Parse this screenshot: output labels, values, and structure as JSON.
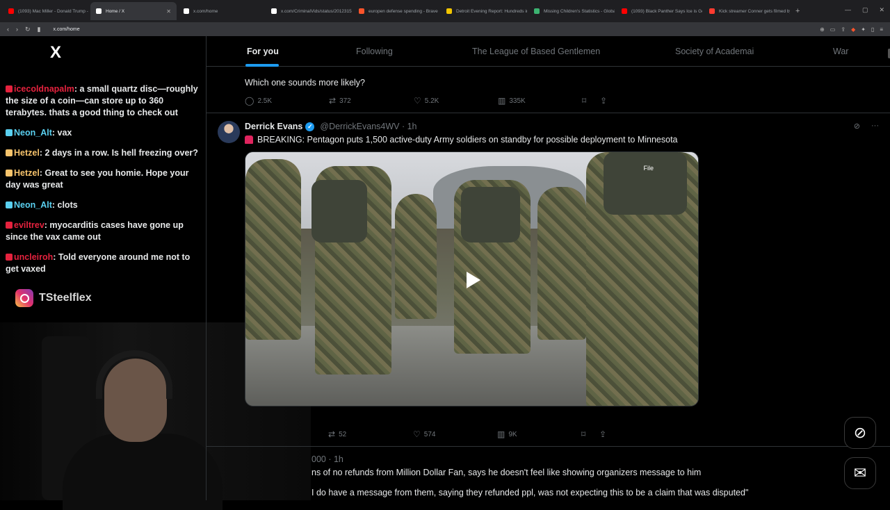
{
  "browser": {
    "tabs": [
      {
        "label": "(1093) Mac Miller - Donald Trump -",
        "color": "#ff0000"
      },
      {
        "label": "Home / X",
        "color": "#ffffff",
        "active": true
      },
      {
        "label": "x.com/home",
        "color": "#ffffff"
      },
      {
        "label": "x.com/CriminalVids/status/20123151",
        "color": "#ffffff"
      },
      {
        "label": "europen defense spending - Brave S",
        "color": "#fb542b"
      },
      {
        "label": "Detroit Evening Report: Hundreds in",
        "color": "#f2c500"
      },
      {
        "label": "Missing Children's Statistics - Global",
        "color": "#3cb371"
      },
      {
        "label": "(1093) Black Panther Says Ice is Gone",
        "color": "#ff0000"
      },
      {
        "label": "Kick streamer Conner gets filmed by",
        "color": "#ff3b30"
      }
    ],
    "url": "x.com/home"
  },
  "chat": {
    "messages": [
      {
        "user": "icecoldnapalm",
        "text": ": a small quartz disc—roughly the size of a coin—can store up to 360 terabytes. thats a good thing to check out",
        "user_color": "#e5223e"
      },
      {
        "user": "Neon_Alt",
        "text": ": vax",
        "user_color": "#5ad0f0"
      },
      {
        "user": "Hetzel",
        "text": ": 2 days in a row. Is hell freezing over?",
        "user_color": "#f7c46c"
      },
      {
        "user": "Hetzel",
        "text": ": Great to see you homie. Hope your day was great",
        "user_color": "#f7c46c"
      },
      {
        "user": "Neon_Alt",
        "text": ": clots",
        "user_color": "#5ad0f0"
      },
      {
        "user": "eviltrev",
        "text": ": myocarditis cases have gone up since the vax came out",
        "user_color": "#e5223e"
      },
      {
        "user": "uncleiroh",
        "text": ": Told everyone around me not to get vaxed",
        "user_color": "#e5223e"
      }
    ],
    "instagram": "TSteelflex"
  },
  "feed": {
    "tabs": [
      "For you",
      "Following",
      "The League of Based Gentlemen",
      "Society of Academai",
      "War"
    ],
    "post1": {
      "text": "Which one sounds more likely?",
      "replies": "2.5K",
      "reposts": "372",
      "likes": "5.2K",
      "views": "335K"
    },
    "post2": {
      "name": "Derrick Evans",
      "handle": "@DerrickEvans4WV · 1h",
      "text": "BREAKING: Pentagon puts 1,500 active-duty Army soldiers on standby for possible deployment to Minnesota",
      "media_label": "File",
      "reposts": "52",
      "likes": "574",
      "views": "9K"
    },
    "post3": {
      "handle_partial": "000 · 1h",
      "text": "ns of no refunds from Million Dollar Fan, says he doesn't feel like showing organizers message to him",
      "text2": "I do have a message from them, saying they refunded ppl, was not expecting this to be a claim that was disputed\""
    }
  }
}
